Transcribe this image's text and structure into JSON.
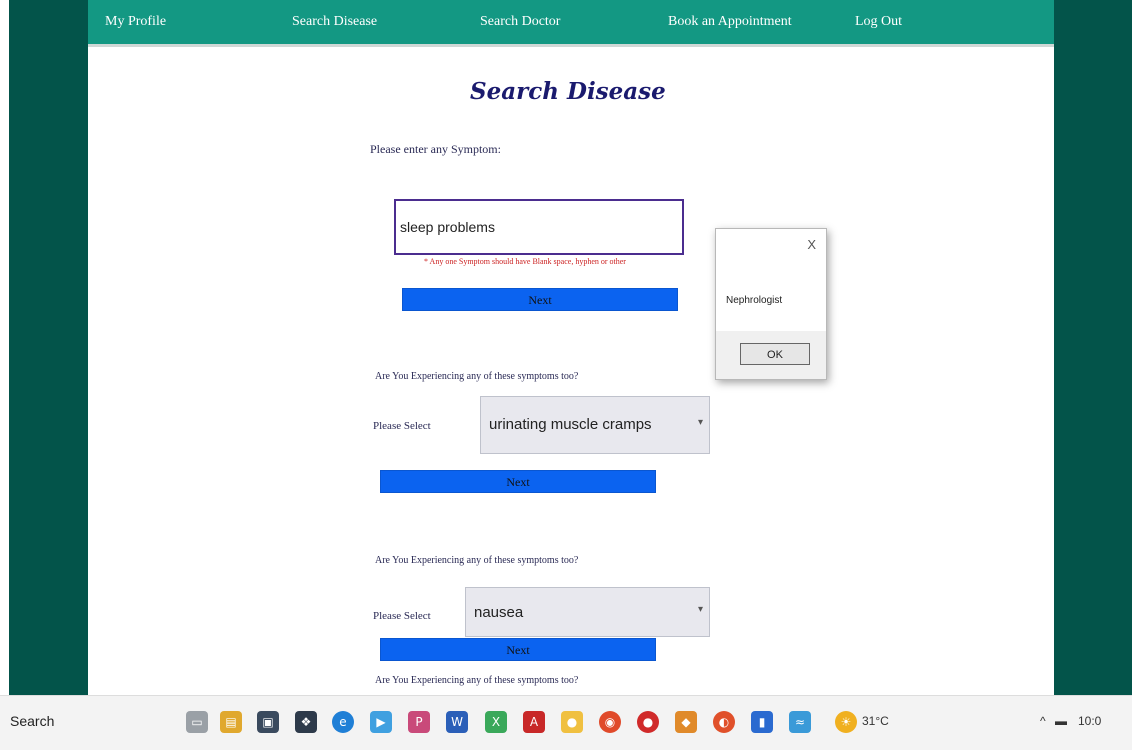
{
  "nav": {
    "items": [
      "My Profile",
      "Search Disease",
      "Search Doctor",
      "Book an Appointment",
      "Log Out"
    ]
  },
  "page": {
    "title": "Search Disease",
    "prompt": "Please enter any Symptom:",
    "symptom_value": "sleep problems",
    "error_hint": "* Any one Symptom should have Blank space, hyphen or other",
    "next_label": "Next",
    "question": "Are You Experiencing any of these symptoms too?",
    "select_label": "Please Select",
    "select1_value": "urinating muscle cramps",
    "select2_value": "nausea"
  },
  "dialog": {
    "close_label": "X",
    "message": "Nephrologist",
    "ok_label": "OK"
  },
  "taskbar": {
    "search_label": "Search",
    "temperature": "31°C",
    "clock": "10:0"
  },
  "colors": {
    "nav_bg": "#139883",
    "page_bg_dark": "#03544a",
    "button_blue": "#0b63f0"
  }
}
